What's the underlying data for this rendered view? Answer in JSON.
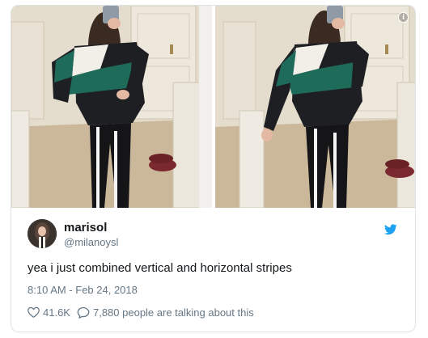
{
  "tweet": {
    "display_name": "marisol",
    "handle": "@milanoysl",
    "text": "yea i just combined vertical and horizontal stripes",
    "timestamp": "8:10 AM - Feb 24, 2018",
    "likes": "41.6K",
    "talking": "7,880 people are talking about this"
  },
  "icons": {
    "info": "info-icon",
    "bird": "twitter-bird-icon",
    "heart": "heart-icon",
    "reply": "speech-bubble-icon"
  },
  "colors": {
    "twitter_blue": "#1da1f2",
    "text_primary": "#14171a",
    "text_secondary": "#657786",
    "border": "#dfe3e7"
  }
}
